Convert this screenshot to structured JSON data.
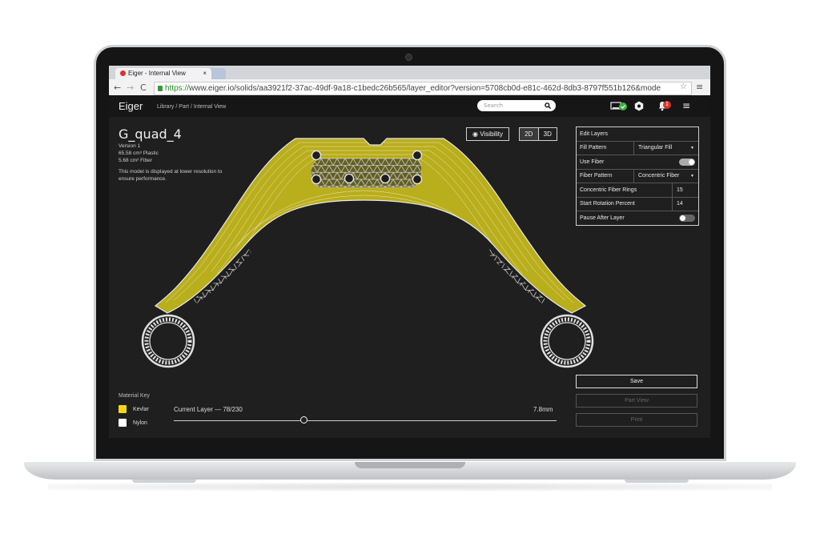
{
  "browser": {
    "tab_title": "Eiger - Internal View",
    "tab_close": "×",
    "url_scheme": "https://",
    "url_rest": "www.eiger.io/solids/aa3921f2-37ac-49df-9a18-c1bedc26b565/layer_editor?version=5708cb0d-e81c-462d-8db3-8797f551b126&mode"
  },
  "app": {
    "brand": "Eiger",
    "breadcrumb": "Library  /  Part  /  Internal View",
    "search_placeholder": "Search",
    "notification_count": "1"
  },
  "part": {
    "name": "G_quad_4",
    "version": "Version 1",
    "plastic": "65.58 cm³ Plastic",
    "fiber": "5.68 cm³ Fiber",
    "note_line1": "This model is displayed at lower resolution to",
    "note_line2": "ensure performance."
  },
  "view": {
    "visibility_label": "Visibility",
    "mode_2d": "2D",
    "mode_3d": "3D"
  },
  "edit_layers": {
    "title": "Edit Layers",
    "fill_pattern_label": "Fill Pattern",
    "fill_pattern_value": "Triangular Fill",
    "use_fiber_label": "Use Fiber",
    "use_fiber_on": true,
    "fiber_pattern_label": "Fiber Pattern",
    "fiber_pattern_value": "Concentric Fiber",
    "rings_label": "Concentric Fiber Rings",
    "rings_value": "15",
    "rotation_label": "Start Rotation Percent",
    "rotation_value": "14",
    "pause_label": "Pause After Layer",
    "pause_on": false
  },
  "actions": {
    "save": "Save",
    "part_view": "Part View",
    "print": "Print"
  },
  "material_key": {
    "title": "Material Key",
    "items": [
      {
        "label": "Kevlar",
        "color": "#f2d90f"
      },
      {
        "label": "Nylon",
        "color": "#ffffff"
      }
    ]
  },
  "layer": {
    "label": "Current Layer — 78/230",
    "height": "7.8mm",
    "current": 78,
    "total": 230
  },
  "colors": {
    "fiber": "#b9ae1c",
    "fill": "#c8c8c8",
    "screen_bg": "#1f1f1f"
  }
}
